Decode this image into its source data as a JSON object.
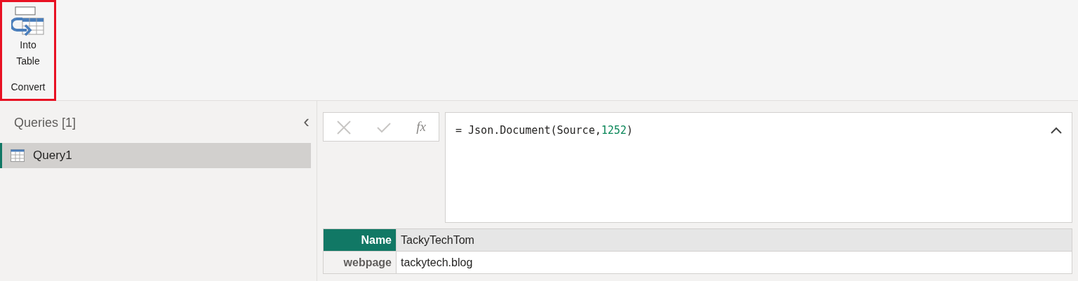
{
  "ribbon": {
    "groups": [
      {
        "label": "Convert",
        "highlighted": true,
        "buttons": [
          {
            "label_lines": [
              "Into",
              "Table"
            ]
          }
        ]
      }
    ]
  },
  "queries_pane": {
    "title": "Queries [1]",
    "collapse": "‹",
    "items": [
      {
        "label": "Query1",
        "selected": true
      }
    ]
  },
  "formula_bar": {
    "cancel_disabled": true,
    "commit_disabled": true,
    "fx": "fx",
    "tokens": [
      {
        "text": "= Json.Document(Source,",
        "kind": "plain"
      },
      {
        "text": "1252",
        "kind": "number"
      },
      {
        "text": ")",
        "kind": "plain"
      }
    ]
  },
  "record": {
    "rows": [
      {
        "field": "Name",
        "value": "TackyTechTom",
        "selected": true
      },
      {
        "field": "webpage",
        "value": "tackytech.blog",
        "selected": false
      }
    ]
  }
}
